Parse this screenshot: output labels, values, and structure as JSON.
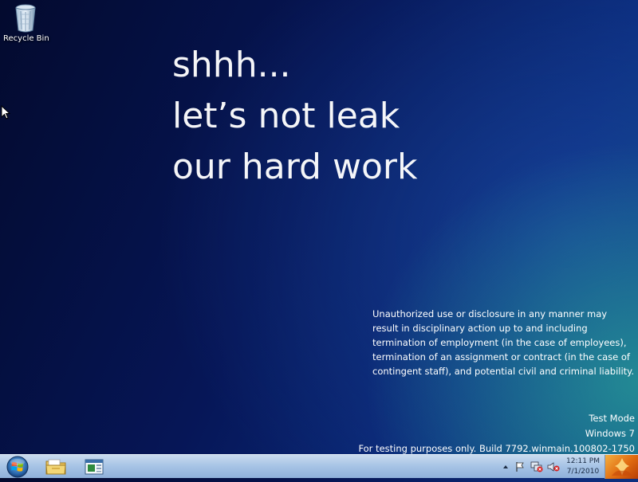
{
  "desktop": {
    "icons": [
      {
        "label": "Recycle Bin",
        "icon": "recycle-bin-icon"
      }
    ]
  },
  "wallpaper": {
    "headline": [
      "shhh...",
      "let’s not leak",
      "our hard work"
    ],
    "disclaimer": "Unauthorized use or disclosure in any manner may result in disciplinary action up to and including termination of employment (in the case of employees), termination of an assignment or contract (in the case of contingent staff), and potential civil and criminal liability."
  },
  "watermark": {
    "line1": "Test Mode",
    "line2": "Windows 7",
    "line3": "For testing purposes only. Build 7792.winmain.100802-1750"
  },
  "taskbar": {
    "pinned": [
      {
        "name": "windows-explorer",
        "icon": "folder-icon"
      },
      {
        "name": "application",
        "icon": "app-window-icon"
      }
    ],
    "tray_icons": [
      "chevron-up-icon",
      "flag-icon",
      "network-icon",
      "speaker-muted-icon"
    ],
    "clock": {
      "time": "12:11 PM",
      "date": "7/1/2010"
    }
  },
  "colors": {
    "taskbar": "#a9c5e6",
    "wallpaper_dark": "#030a2e",
    "wallpaper_accent": "#28a096"
  }
}
